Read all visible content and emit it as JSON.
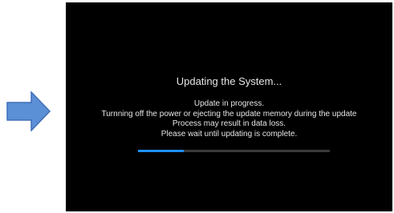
{
  "icons": {
    "arrow": "right-arrow-icon"
  },
  "colors": {
    "arrow_fill": "#5b8fd6",
    "arrow_stroke": "#3e6fb8",
    "screen_background": "#000000",
    "text": "#e6e6e6",
    "progress_fill": "#1e90ff",
    "progress_track": "#3a3a3a"
  },
  "update_screen": {
    "title": "Updating the System...",
    "message_lines": [
      "Update in progress.",
      "Turnning off the power or ejecting the update memory during the update",
      "Process may result in data loss.",
      "Please wait until updating is complete."
    ],
    "progress": 0.24
  }
}
